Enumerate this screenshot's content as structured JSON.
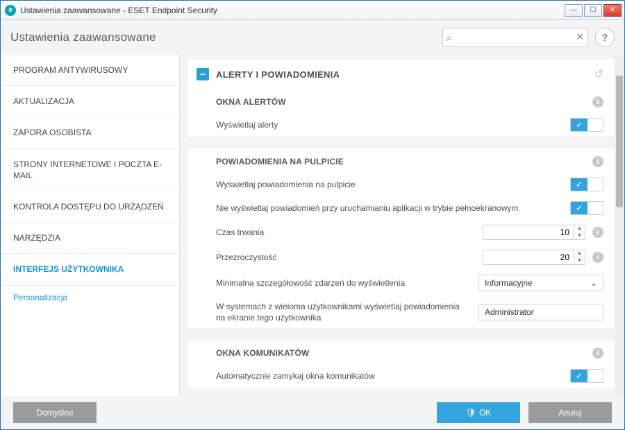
{
  "window": {
    "title": "Ustawienia zaawansowane - ESET Endpoint Security"
  },
  "header": {
    "title": "Ustawienia zaawansowane",
    "search_placeholder": ""
  },
  "sidebar": {
    "items": [
      {
        "label": "PROGRAM ANTYWIRUSOWY"
      },
      {
        "label": "AKTUALIZACJA"
      },
      {
        "label": "ZAPORA OSOBISTA"
      },
      {
        "label": "STRONY INTERNETOWE I POCZTA E-MAIL"
      },
      {
        "label": "KONTROLA DOSTĘPU DO URZĄDZEŃ"
      },
      {
        "label": "NARZĘDZIA"
      },
      {
        "label": "INTERFEJS UŻYTKOWNIKA"
      }
    ],
    "sub": "Personalizacja"
  },
  "content": {
    "section_title": "ALERTY I POWIADOMIENIA",
    "groups": {
      "okna_alertow": {
        "title": "OKNA ALERTÓW",
        "show_alerts_label": "Wyświetlaj alerty",
        "show_alerts_value": true
      },
      "pulpit": {
        "title": "POWIADOMIENIA NA PULPICIE",
        "show_desktop_label": "Wyświetlaj powiadomienia na pulpicie",
        "show_desktop_value": true,
        "no_fullscreen_label": "Nie wyświetlaj powiadomień przy uruchamianiu aplikacji w trybie pełnoekranowym",
        "no_fullscreen_value": true,
        "duration_label": "Czas trwania",
        "duration_value": "10",
        "transparency_label": "Przezroczystość",
        "transparency_value": "20",
        "min_severity_label": "Minimalna szczegółowość zdarzeń do wyświetlenia",
        "min_severity_value": "Informacyjne",
        "multiuser_label": "W systemach z wieloma użytkownikami wyświetlaj powiadomienia na ekranie tego użytkownika",
        "multiuser_value": "Administrator"
      },
      "komunikaty": {
        "title": "OKNA KOMUNIKATÓW",
        "autoclose_label": "Automatycznie zamykaj okna komunikatów",
        "autoclose_value": true
      }
    }
  },
  "footer": {
    "default_label": "Domyślne",
    "ok_label": "OK",
    "cancel_label": "Anuluj"
  },
  "glyphs": {
    "check": "✓",
    "chevron_down": "⌄",
    "help": "?",
    "info": "i",
    "search": "⌕",
    "clear": "✕",
    "minus": "−",
    "reset": "↺",
    "shield": "🛡",
    "min": "—",
    "max": "☐",
    "close": "✕",
    "up": "▲",
    "down": "▼"
  }
}
